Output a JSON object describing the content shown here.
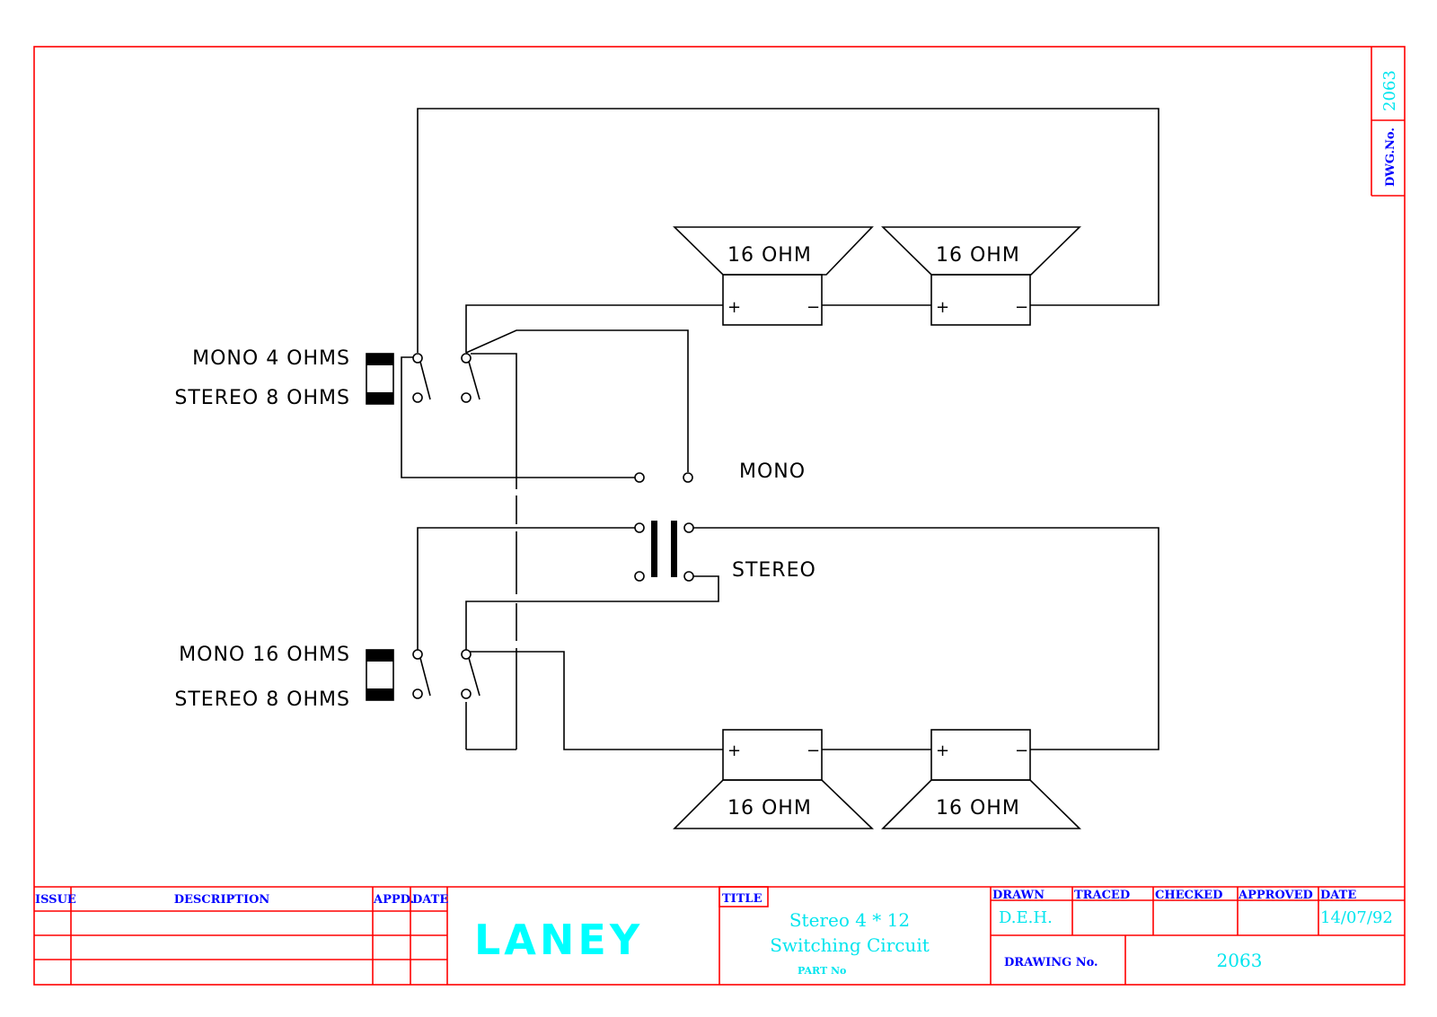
{
  "drawing": {
    "dwg_no_label": "DWG.No.",
    "dwg_no_value": "2063"
  },
  "schematic": {
    "switch_top": {
      "label_a": "MONO  4  OHMS",
      "label_b": "STEREO  8  OHMS"
    },
    "switch_bottom": {
      "label_a": "MONO  16  OHMS",
      "label_b": "STEREO  8  OHMS"
    },
    "jack": {
      "mono_label": "MONO",
      "stereo_label": "STEREO"
    },
    "speakers": [
      {
        "label": "16  OHM",
        "plus": "+",
        "minus": "−"
      },
      {
        "label": "16  OHM",
        "plus": "+",
        "minus": "−"
      },
      {
        "label": "16  OHM",
        "plus": "+",
        "minus": "−"
      },
      {
        "label": "16  OHM",
        "plus": "+",
        "minus": "−"
      }
    ]
  },
  "title_block": {
    "revisions": {
      "headers": [
        "ISSUE",
        "DESCRIPTION",
        "APPD.",
        "DATE"
      ],
      "rows": [
        [
          "",
          "",
          "",
          ""
        ],
        [
          "",
          "",
          "",
          ""
        ],
        [
          "",
          "",
          "",
          ""
        ]
      ]
    },
    "logo": "LANEY",
    "title_label": "TITLE",
    "title_line1": "Stereo 4 * 12",
    "title_line2": "Switching Circuit",
    "part_no_label": "PART No",
    "signoff_headers": [
      "DRAWN",
      "TRACED",
      "CHECKED",
      "APPROVED",
      "DATE"
    ],
    "signoff_values": [
      "D.E.H.",
      "",
      "",
      "",
      "14/07/92"
    ],
    "drawing_no_label": "DRAWING No.",
    "drawing_no_value": "2063"
  },
  "colors": {
    "border": "#ff0000",
    "header_text": "#0000ff",
    "value_text": "#00e5ee",
    "wire": "#000000"
  }
}
